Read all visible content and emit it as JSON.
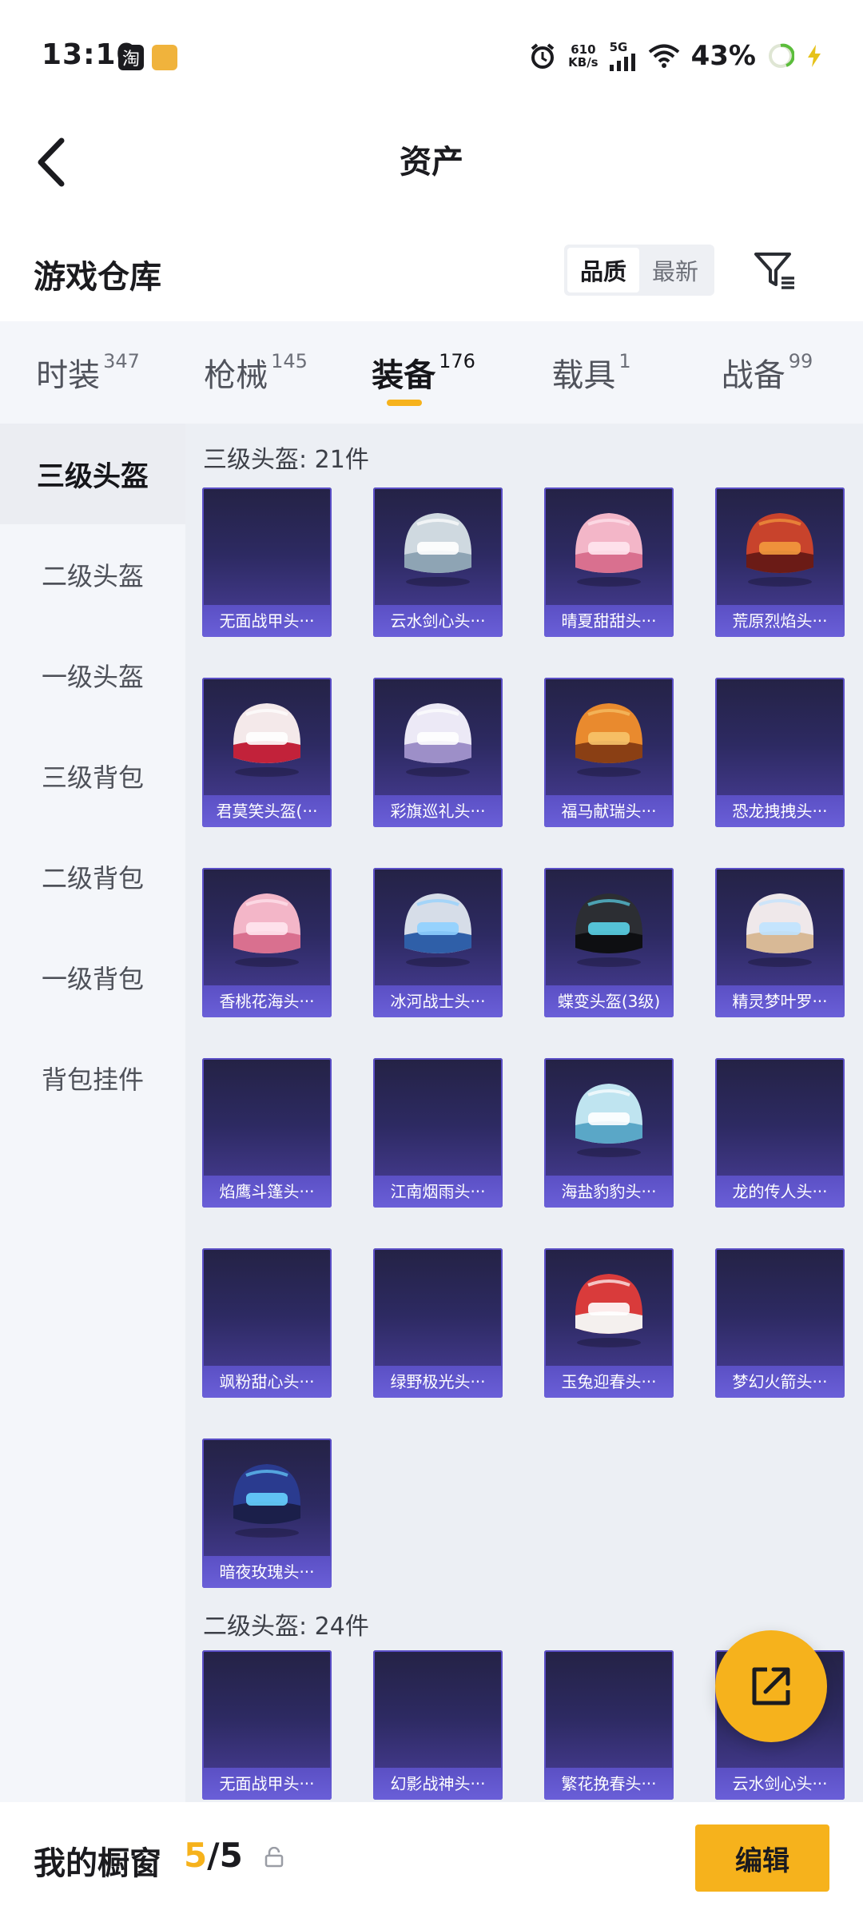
{
  "status_bar": {
    "time": "13:10",
    "speed": "610",
    "speed_unit": "KB/s",
    "network": "5G",
    "battery": "43%"
  },
  "header": {
    "title": "资产"
  },
  "warehouse": {
    "title": "游戏仓库",
    "sort_options": [
      "品质",
      "最新"
    ],
    "active_sort": "品质"
  },
  "category_tabs": [
    {
      "label": "时装",
      "count": "347"
    },
    {
      "label": "枪械",
      "count": "145"
    },
    {
      "label": "装备",
      "count": "176",
      "active": true
    },
    {
      "label": "载具",
      "count": "1"
    },
    {
      "label": "战备",
      "count": "99"
    }
  ],
  "sidebar": {
    "items": [
      "三级头盔",
      "二级头盔",
      "一级头盔",
      "三级背包",
      "二级背包",
      "一级背包",
      "背包挂件"
    ],
    "active": "三级头盔"
  },
  "sections": [
    {
      "title": "三级头盔: 21件",
      "items": [
        {
          "name": "无面战甲头···",
          "art": "none"
        },
        {
          "name": "云水剑心头···",
          "art": "helmet-silver"
        },
        {
          "name": "晴夏甜甜头···",
          "art": "helmet-pink"
        },
        {
          "name": "荒原烈焰头···",
          "art": "helmet-red"
        },
        {
          "name": "君莫笑头盔(···",
          "art": "helmet-mask"
        },
        {
          "name": "彩旗巡礼头···",
          "art": "helmet-white"
        },
        {
          "name": "福马献瑞头···",
          "art": "helmet-orange"
        },
        {
          "name": "恐龙拽拽头···",
          "art": "none"
        },
        {
          "name": "香桃花海头···",
          "art": "helmet-pink"
        },
        {
          "name": "冰河战士头···",
          "art": "helmet-blue"
        },
        {
          "name": "蝶变头盔(3级)",
          "art": "helmet-black"
        },
        {
          "name": "精灵梦叶罗···",
          "art": "helmet-winged"
        },
        {
          "name": "焰鹰斗篷头···",
          "art": "none"
        },
        {
          "name": "江南烟雨头···",
          "art": "none"
        },
        {
          "name": "海盐豹豹头···",
          "art": "helmet-cyan"
        },
        {
          "name": "龙的传人头···",
          "art": "none"
        },
        {
          "name": "飒粉甜心头···",
          "art": "none"
        },
        {
          "name": "绿野极光头···",
          "art": "none"
        },
        {
          "name": "玉兔迎春头···",
          "art": "helmet-redwhite"
        },
        {
          "name": "梦幻火箭头···",
          "art": "none"
        },
        {
          "name": "暗夜玫瑰头···",
          "art": "helmet-navy"
        }
      ]
    },
    {
      "title": "二级头盔: 24件",
      "items": [
        {
          "name": "无面战甲头···",
          "art": "none"
        },
        {
          "name": "幻影战神头···",
          "art": "none"
        },
        {
          "name": "繁花挽春头···",
          "art": "none"
        },
        {
          "name": "云水剑心头···",
          "art": "none"
        }
      ]
    }
  ],
  "showcase": {
    "label": "我的橱窗",
    "current": "5",
    "separator": "/",
    "total": "5",
    "edit_label": "编辑"
  },
  "colors": {
    "accent": "#f6b21c",
    "card_caption": "#5b50c4"
  }
}
